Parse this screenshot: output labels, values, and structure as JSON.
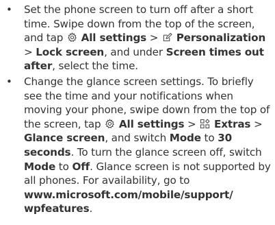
{
  "tips": [
    {
      "bullet": "•",
      "t1": "Set the phone screen to turn off after a short time. Swipe down from the top of the screen, and tap ",
      "settings_icon": "gear-icon",
      "all_settings": "All settings",
      "sep1": " > ",
      "personalization_icon": "pencil-icon",
      "personalization": "Personalization",
      "sep2": " > ",
      "lock_screen": "Lock screen",
      "t2": ", and under ",
      "screen_times_out_after": "Screen times out after",
      "t3": ", select the time."
    },
    {
      "bullet": "•",
      "t1": "Change the glance screen settings. To briefly see the time and your notifications when moving your phone, swipe down from the top of the screen, tap ",
      "settings_icon": "gear-icon",
      "all_settings": "All settings",
      "sep1": " > ",
      "extras_icon": "extras-icon",
      "extras": "Extras",
      "sep2": " > ",
      "glance_screen": "Glance screen",
      "t2": ", and switch ",
      "mode": "Mode",
      "t3": " to ",
      "thirty_seconds": "30 seconds",
      "t4": ". To turn the glance screen off, switch ",
      "mode2": "Mode",
      "t5": " to ",
      "off": "Off",
      "t6": ". Glance screen is not supported by all phones. For availability, go to ",
      "url": "www.microsoft.com/mobile/support/wpfeatures",
      "t7": "."
    }
  ]
}
